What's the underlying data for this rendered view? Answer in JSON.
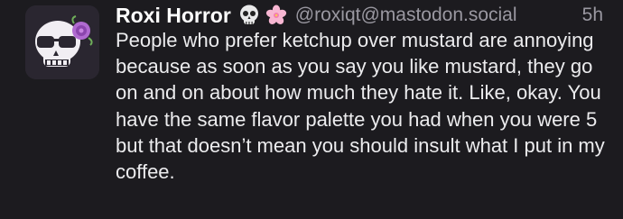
{
  "post": {
    "author": {
      "display_name": "Roxi Horror",
      "emojis": [
        "skull-emoji",
        "cherry-blossom-emoji"
      ],
      "handle": "@roxiqt@mastodon.social"
    },
    "timestamp": "5h",
    "content": "People who prefer ketchup over mustard are annoying because as soon as you say you like mustard, they go on and on about how much they hate it. Like, okay. You have the same flavor palette you had when you were 5 but that doesn’t mean you should insult what I put in my coffee."
  },
  "colors": {
    "background": "#1c1b1f",
    "text": "#ececee",
    "muted": "#9a98a1"
  }
}
